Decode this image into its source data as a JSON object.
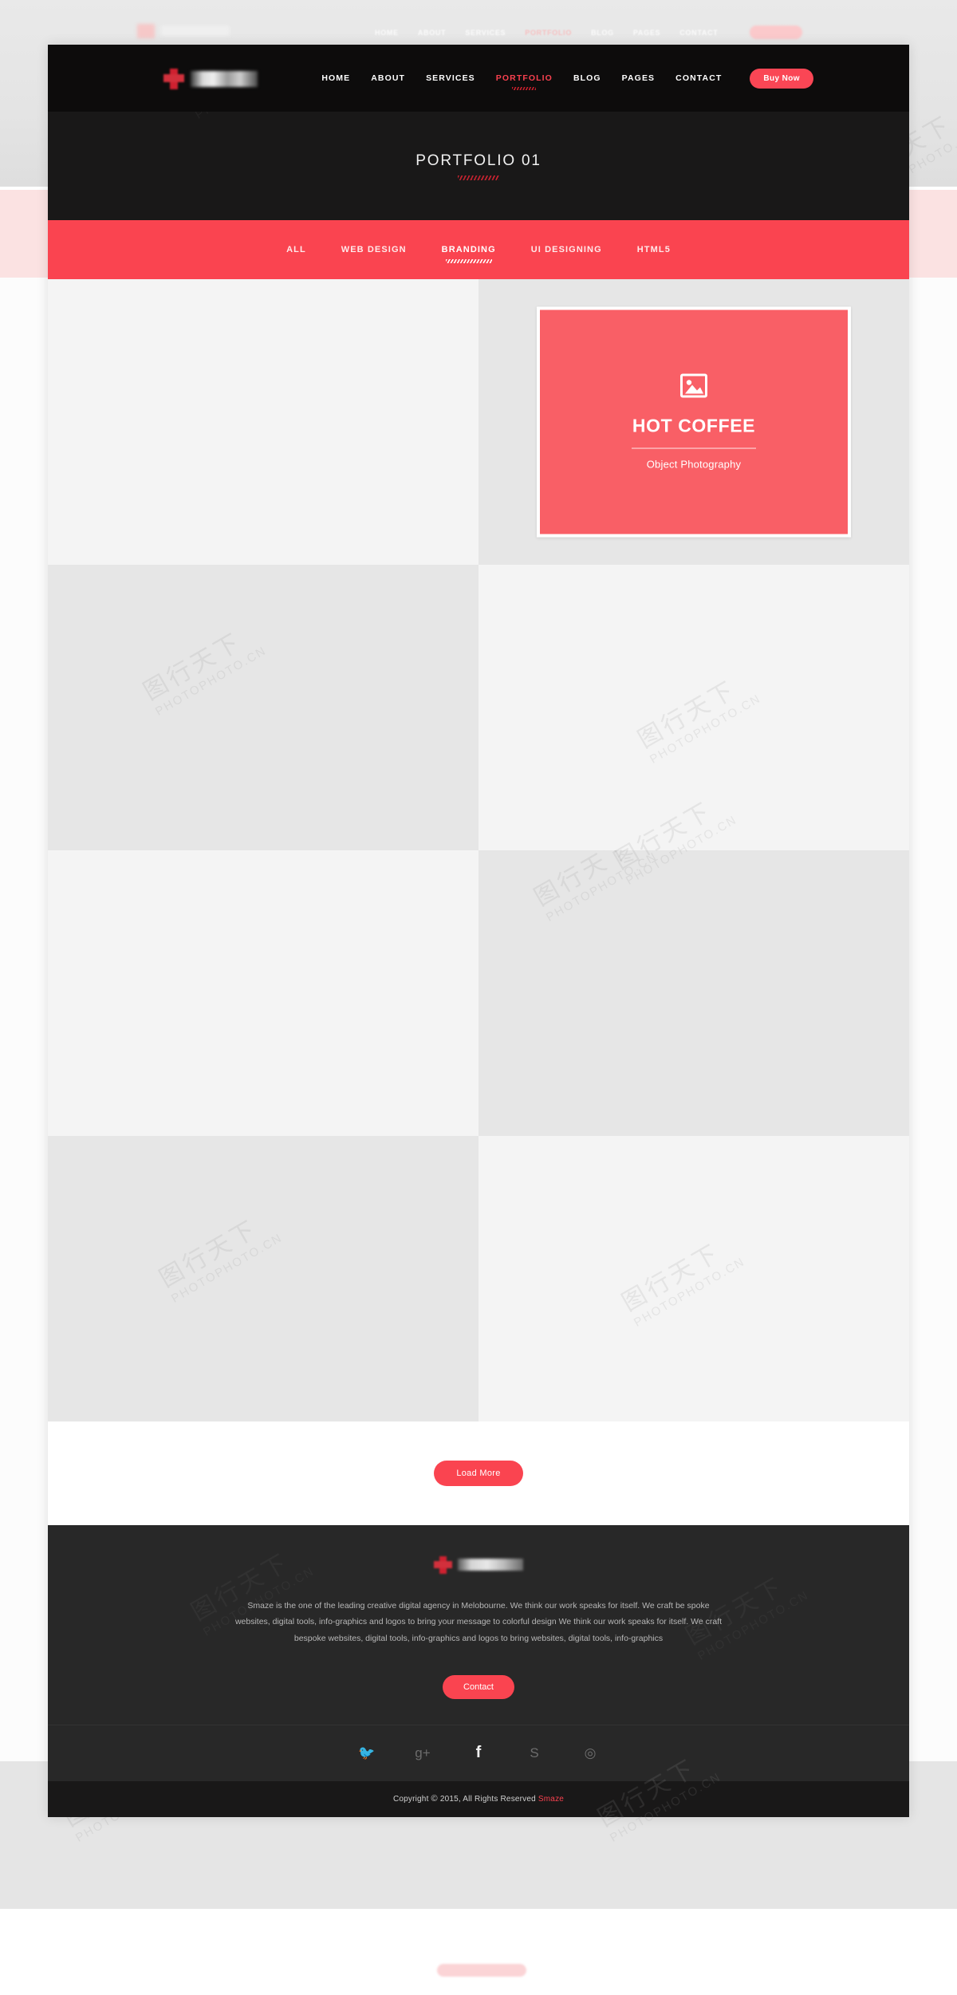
{
  "colors": {
    "accent": "#fa4450",
    "accent_light": "#f95f66",
    "header_bg": "#0d0c0c",
    "hero_bg": "#191818",
    "footer_bg": "#282828",
    "copyright_bg": "#191818"
  },
  "background_page": {
    "nav_items": [
      "HOME",
      "ABOUT",
      "SERVICES",
      "PORTFOLIO",
      "BLOG",
      "PAGES",
      "CONTACT"
    ],
    "active_nav": "PORTFOLIO"
  },
  "watermark": {
    "text_cn": "图行天下",
    "text_en": "PHOTOPHOTO.CN"
  },
  "header": {
    "logo_alt": "smaze-logo",
    "nav": [
      {
        "label": "HOME",
        "active": false
      },
      {
        "label": "ABOUT",
        "active": false
      },
      {
        "label": "SERVICES",
        "active": false
      },
      {
        "label": "PORTFOLIO",
        "active": true
      },
      {
        "label": "BLOG",
        "active": false
      },
      {
        "label": "PAGES",
        "active": false
      },
      {
        "label": "CONTACT",
        "active": false
      }
    ],
    "buy_now_label": "Buy Now"
  },
  "hero": {
    "title": "PORTFOLIO 01"
  },
  "filters": [
    {
      "label": "ALL",
      "active": false
    },
    {
      "label": "WEB DESIGN",
      "active": false
    },
    {
      "label": "BRANDING",
      "active": true
    },
    {
      "label": "UI DESIGNING",
      "active": false
    },
    {
      "label": "HTML5",
      "active": false
    }
  ],
  "portfolio": {
    "items": [
      {
        "title": "",
        "category": "",
        "tone": "tone-a",
        "filled": false
      },
      {
        "title": "HOT COFFEE",
        "category": "Object Photography",
        "tone": "tone-b",
        "filled": true
      },
      {
        "title": "",
        "category": "",
        "tone": "tone-b",
        "filled": false
      },
      {
        "title": "",
        "category": "",
        "tone": "tone-a",
        "filled": false
      },
      {
        "title": "",
        "category": "",
        "tone": "tone-a",
        "filled": false
      },
      {
        "title": "",
        "category": "",
        "tone": "tone-b",
        "filled": false
      },
      {
        "title": "",
        "category": "",
        "tone": "tone-b",
        "filled": false
      },
      {
        "title": "",
        "category": "",
        "tone": "tone-a",
        "filled": false
      }
    ],
    "load_more_label": "Load More"
  },
  "footer": {
    "logo_alt": "smaze-logo",
    "about": "Smaze is the one of the leading creative digital agency in Melobourne. We think our work speaks for itself. We craft be spoke websites, digital tools, info-graphics and logos to bring your message to colorful design We think our work speaks for itself. We craft bespoke websites, digital tools, info-graphics and logos to bring websites, digital tools, info-graphics",
    "contact_label": "Contact",
    "social": [
      {
        "name": "twitter-icon",
        "glyph": "🐦",
        "highlight": false
      },
      {
        "name": "google-plus-icon",
        "glyph": "g+",
        "highlight": false
      },
      {
        "name": "facebook-icon",
        "glyph": "f",
        "highlight": true
      },
      {
        "name": "skype-icon",
        "glyph": "S",
        "highlight": false
      },
      {
        "name": "dribbble-icon",
        "glyph": "◎",
        "highlight": false
      }
    ],
    "copyright_prefix": "Copyright",
    "copyright_mark": "©",
    "copyright_text": "2015, All Rights Reserved",
    "copyright_brand": "Smaze"
  }
}
